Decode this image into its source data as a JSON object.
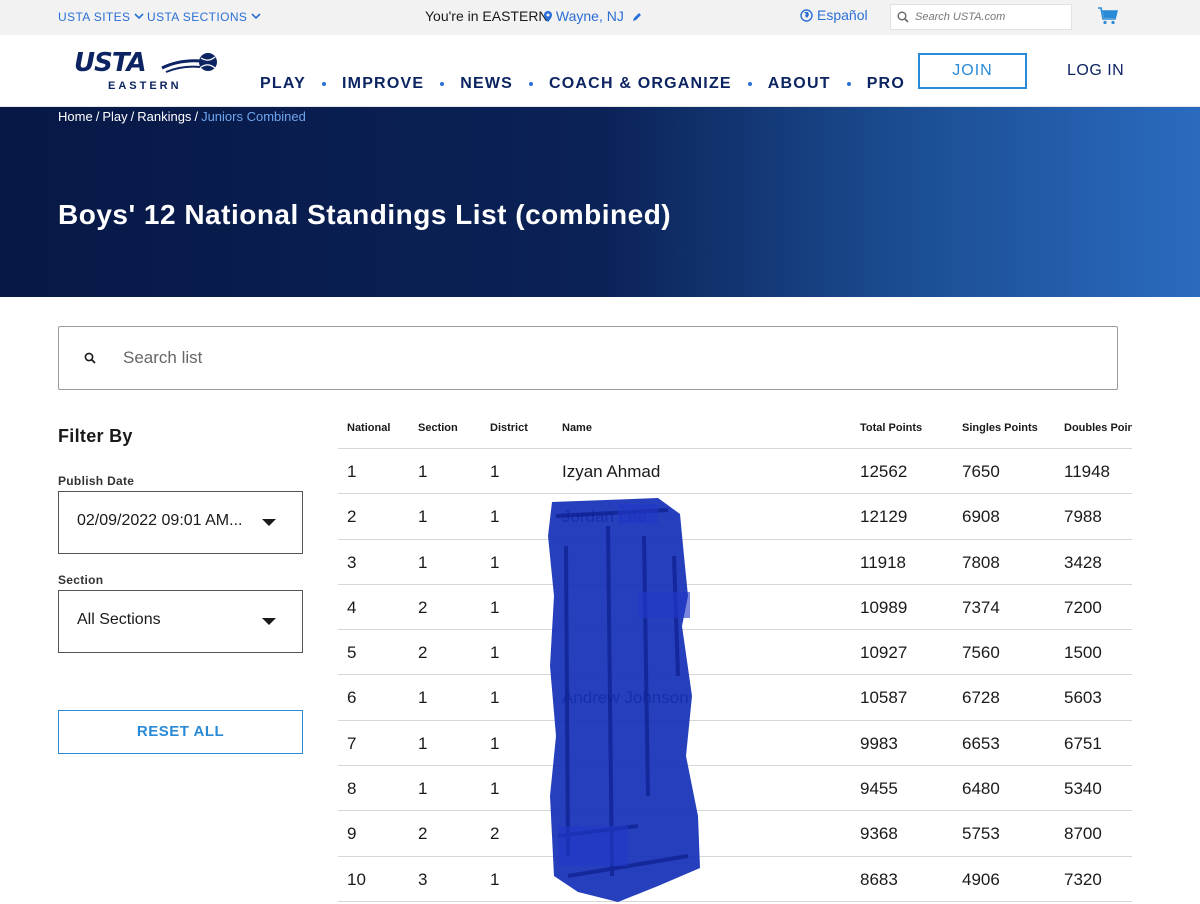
{
  "utility": {
    "sites_label": "USTA SITES",
    "sections_label": "USTA SECTIONS",
    "location_prefix": "You're in EASTERN",
    "location_city": "Wayne, NJ",
    "language_label": "Español",
    "search_placeholder": "Search USTA.com"
  },
  "header": {
    "logo_text": "USTA",
    "logo_sub": "EASTERN",
    "nav": [
      "PLAY",
      "IMPROVE",
      "NEWS",
      "COACH & ORGANIZE",
      "ABOUT",
      "PRO"
    ],
    "join_label": "JOIN",
    "login_label": "LOG IN"
  },
  "hero": {
    "breadcrumb": [
      "Home",
      "Play",
      "Rankings",
      "Juniors Combined"
    ],
    "title": "Boys' 12 National Standings List (combined)"
  },
  "list_search": {
    "placeholder": "Search list"
  },
  "filters": {
    "title": "Filter By",
    "publish_date_label": "Publish Date",
    "publish_date_value": "02/09/2022 09:01 AM...",
    "section_label": "Section",
    "section_value": "All Sections",
    "reset_label": "RESET ALL"
  },
  "table": {
    "headers": [
      "National",
      "Section",
      "District",
      "Name",
      "Total Points",
      "Singles Points",
      "Doubles Point"
    ],
    "rows": [
      {
        "national": "1",
        "section": "1",
        "district": "1",
        "name": "Izyan Ahmad",
        "total": "12562",
        "singles": "7650",
        "doubles": "11948"
      },
      {
        "national": "2",
        "section": "1",
        "district": "1",
        "name": "Jordan Lee",
        "total": "12129",
        "singles": "6908",
        "doubles": "7988"
      },
      {
        "national": "3",
        "section": "1",
        "district": "1",
        "name": "",
        "total": "11918",
        "singles": "7808",
        "doubles": "3428"
      },
      {
        "national": "4",
        "section": "2",
        "district": "1",
        "name": "",
        "total": "10989",
        "singles": "7374",
        "doubles": "7200"
      },
      {
        "national": "5",
        "section": "2",
        "district": "1",
        "name": "",
        "total": "10927",
        "singles": "7560",
        "doubles": "1500"
      },
      {
        "national": "6",
        "section": "1",
        "district": "1",
        "name": "Andrew Johnson",
        "total": "10587",
        "singles": "6728",
        "doubles": "5603"
      },
      {
        "national": "7",
        "section": "1",
        "district": "1",
        "name": "",
        "total": "9983",
        "singles": "6653",
        "doubles": "6751"
      },
      {
        "national": "8",
        "section": "1",
        "district": "1",
        "name": "",
        "total": "9455",
        "singles": "6480",
        "doubles": "5340"
      },
      {
        "national": "9",
        "section": "2",
        "district": "2",
        "name": "",
        "total": "9368",
        "singles": "5753",
        "doubles": "8700"
      },
      {
        "national": "10",
        "section": "3",
        "district": "1",
        "name": "",
        "total": "8683",
        "singles": "4906",
        "doubles": "7320"
      }
    ]
  },
  "colors": {
    "navy": "#0c2462",
    "accent_blue": "#2a6fd6",
    "join_blue": "#2a8ad6",
    "redaction": "#1530b8"
  }
}
